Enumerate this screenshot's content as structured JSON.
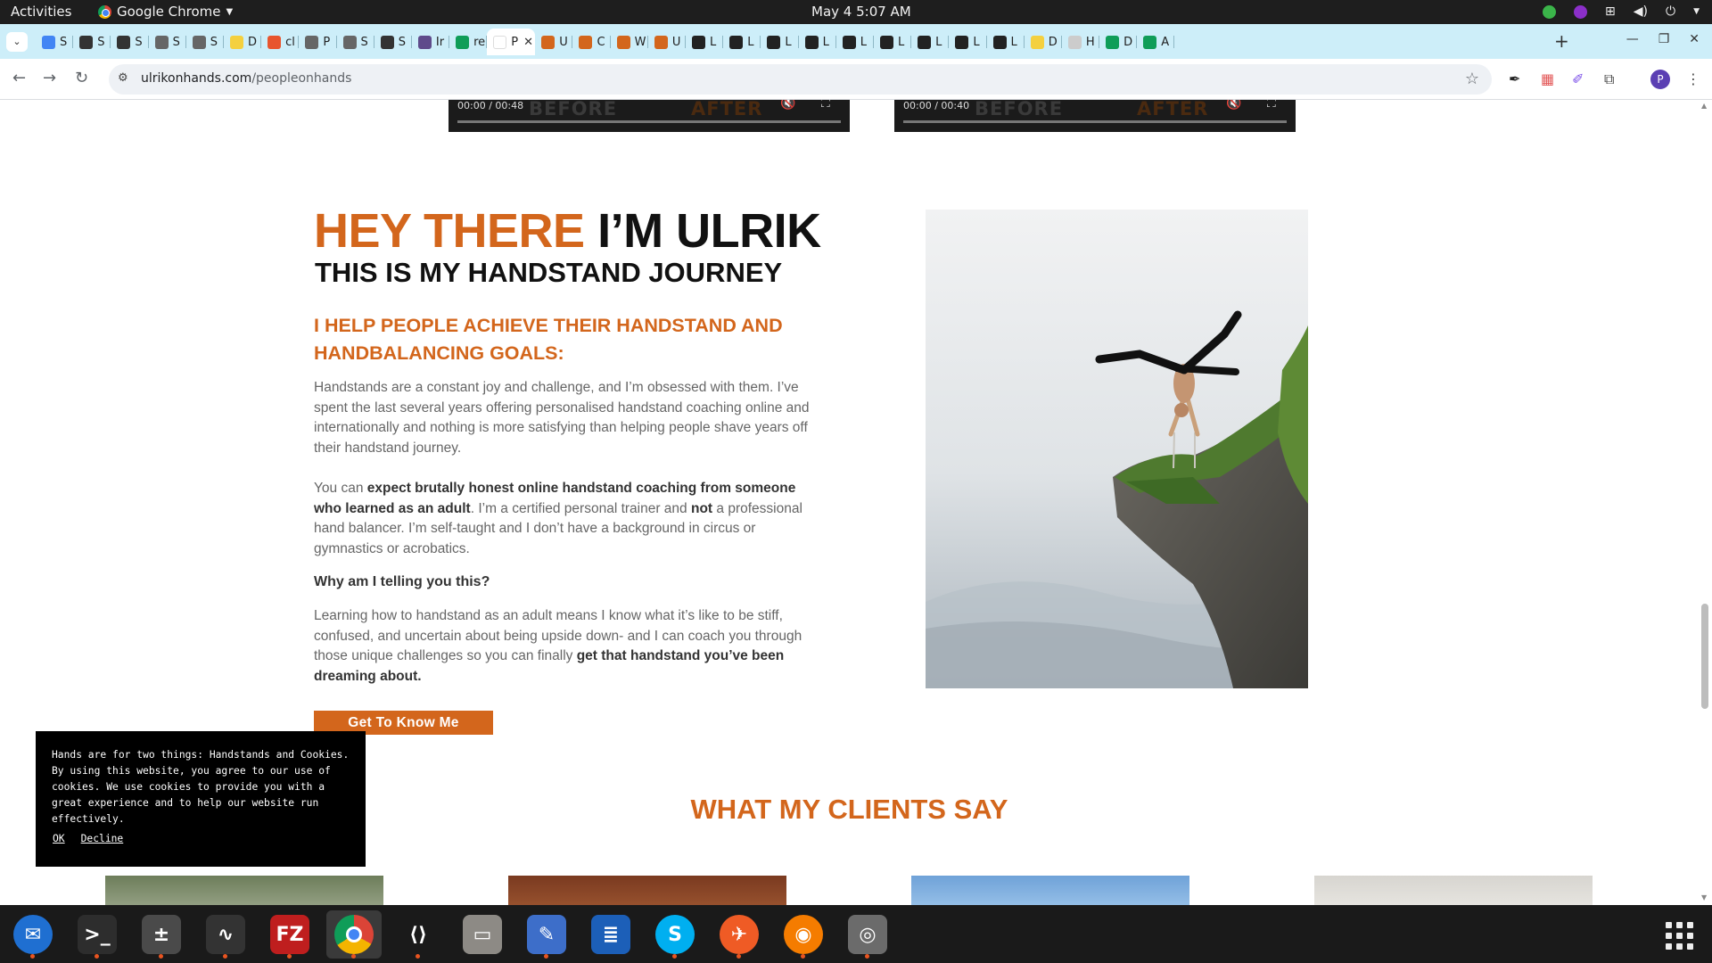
{
  "system": {
    "activities": "Activities",
    "app_name": "Google Chrome",
    "clock": "May 4  5:07 AM"
  },
  "browser": {
    "tabs": [
      {
        "label": "S",
        "color": "#4285f4"
      },
      {
        "label": "S",
        "color": "#333333"
      },
      {
        "label": "S",
        "color": "#333333"
      },
      {
        "label": "S",
        "color": "#666666"
      },
      {
        "label": "S",
        "color": "#666666"
      },
      {
        "label": "D",
        "color": "#f4d03f"
      },
      {
        "label": "cl",
        "color": "#e8552e"
      },
      {
        "label": "P",
        "color": "#666666"
      },
      {
        "label": "S",
        "color": "#666666"
      },
      {
        "label": "S",
        "color": "#333333"
      },
      {
        "label": "Ir",
        "color": "#5f4b8b"
      },
      {
        "label": "re",
        "color": "#0f9d58"
      },
      {
        "label": "P",
        "color": "#ffffff",
        "active": true
      },
      {
        "label": "U",
        "color": "#d3661c"
      },
      {
        "label": "C",
        "color": "#d3661c"
      },
      {
        "label": "W",
        "color": "#d3661c"
      },
      {
        "label": "U",
        "color": "#d3661c"
      },
      {
        "label": "L",
        "color": "#222222"
      },
      {
        "label": "L",
        "color": "#222222"
      },
      {
        "label": "L",
        "color": "#222222"
      },
      {
        "label": "L",
        "color": "#222222"
      },
      {
        "label": "L",
        "color": "#222222"
      },
      {
        "label": "L",
        "color": "#222222"
      },
      {
        "label": "L",
        "color": "#222222"
      },
      {
        "label": "L",
        "color": "#222222"
      },
      {
        "label": "L",
        "color": "#222222"
      },
      {
        "label": "D",
        "color": "#f4d03f"
      },
      {
        "label": "H",
        "color": "#cccccc"
      },
      {
        "label": "D",
        "color": "#0f9d58"
      },
      {
        "label": "A",
        "color": "#0f9d58"
      }
    ],
    "active_tab_close": "✕",
    "new_tab": "+",
    "url_host": "ulrikonhands.com",
    "url_path": "/peopleonhands"
  },
  "page": {
    "videos": [
      {
        "time": "00:00 / 00:48",
        "before": "BEFORE",
        "after": "AFTER"
      },
      {
        "time": "00:00 / 00:40",
        "before": "BEFORE",
        "after": "AFTER"
      }
    ],
    "hero_orange": "HEY THERE",
    "hero_dark": "I’M ULRIK",
    "hero_sub": "THIS IS MY HANDSTAND JOURNEY",
    "help_heading": "I HELP PEOPLE ACHIEVE THEIR HANDSTAND AND HANDBALANCING GOALS:",
    "para1": "Handstands are a constant joy and challenge, and I’m obsessed with them. I’ve spent the last several years offering personalised handstand coaching online and internationally and nothing is more satisfying than helping people shave years off their handstand journey.",
    "para2_a": "You can ",
    "para2_b": "expect brutally honest online handstand coaching from someone who learned as an adult",
    "para2_c": ". I’m a certified personal trainer and ",
    "para2_d": "not",
    "para2_e": " a professional hand balancer. I’m self-taught and I don’t have a background in circus or gymnastics or acrobatics.",
    "why": "Why am I telling you this?",
    "para3_a": "Learning how to handstand as an adult means I know what it’s like to be stiff, confused, and uncertain about being upside down- and I can coach you through those unique challenges so you can finally ",
    "para3_b": "get that handstand you’ve been dreaming about.",
    "cta": "Get To Know Me",
    "clients_title": "WHAT MY CLIENTS SAY",
    "cookie_text": "Hands are for two things: Handstands and Cookies. By using this website, you agree to our use of cookies. We use cookies to provide you with a great experience and to help our website run effectively.",
    "cookie_ok": "OK",
    "cookie_decline": "Decline"
  },
  "dock": [
    {
      "name": "thunderbird",
      "color": "#1f6fd1",
      "glyph": "✉"
    },
    {
      "name": "terminal",
      "color": "#2d2d2d",
      "glyph": ">_"
    },
    {
      "name": "calculator",
      "color": "#4a4a4a",
      "glyph": "±"
    },
    {
      "name": "system-monitor",
      "color": "#333333",
      "glyph": "∿"
    },
    {
      "name": "filezilla",
      "color": "#bf1e1e",
      "glyph": "FZ"
    },
    {
      "name": "chrome",
      "color": "#ffffff",
      "glyph": ""
    },
    {
      "name": "vscode",
      "color": "#1a1a1a",
      "glyph": "⟨⟩"
    },
    {
      "name": "files",
      "color": "#8d8a85",
      "glyph": "▭"
    },
    {
      "name": "text-editor",
      "color": "#3d6ec9",
      "glyph": "✎"
    },
    {
      "name": "writer",
      "color": "#1c5fb8",
      "glyph": "≣"
    },
    {
      "name": "skype",
      "color": "#00aff0",
      "glyph": "S"
    },
    {
      "name": "postman",
      "color": "#ef5b25",
      "glyph": "✈"
    },
    {
      "name": "blender",
      "color": "#f57c00",
      "glyph": "◉"
    },
    {
      "name": "disks",
      "color": "#6b6b6b",
      "glyph": "◎"
    }
  ]
}
